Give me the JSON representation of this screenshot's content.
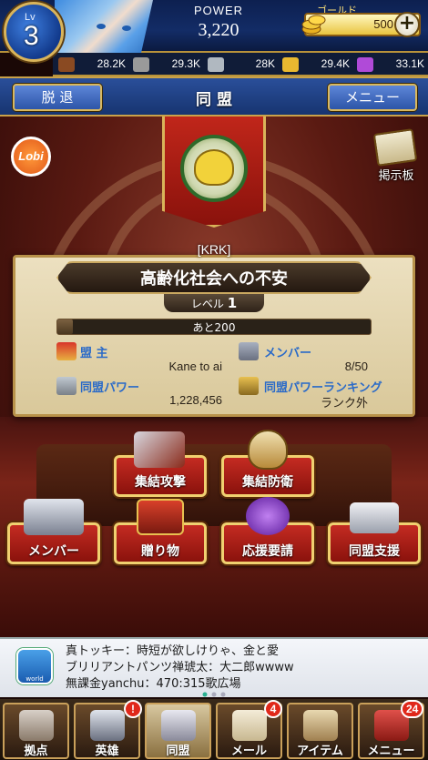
{
  "header": {
    "level_prefix": "Lv",
    "level": "3",
    "power_label": "POWER",
    "power_value": "3,220",
    "gold_label": "ゴールド",
    "gold_value": "500",
    "gold_add": "+"
  },
  "resources": [
    {
      "icon": "wood-log-icon",
      "value": "28.2K",
      "color": "#8a4a22"
    },
    {
      "icon": "stone-icon",
      "value": "29.3K",
      "color": "#9a9a9a"
    },
    {
      "icon": "iron-ingot-icon",
      "value": "28K",
      "color": "#b0b8c0"
    },
    {
      "icon": "gold-key-icon",
      "value": "29.4K",
      "color": "#e8b830"
    },
    {
      "icon": "crystal-icon",
      "value": "33.1K",
      "color": "#b04ad8"
    }
  ],
  "nav": {
    "leave_label": "脱 退",
    "title": "同 盟",
    "menu_label": "メニュー"
  },
  "side": {
    "lobi_label": "Lobi",
    "board_label": "掲示板"
  },
  "alliance": {
    "tag": "[KRK]",
    "name": "高齢化社会への不安",
    "level_label": "レベル",
    "level": "1",
    "xp_text": "あと200",
    "xp_progress": 0.05,
    "leader_label": "盟 主",
    "leader": "Kane to ai",
    "members_label": "メンバー",
    "members": "8/50",
    "power_label": "同盟パワー",
    "power": "1,228,456",
    "ranking_label": "同盟パワーランキング",
    "ranking": "ランク外"
  },
  "actions": {
    "rally_attack": "集結攻撃",
    "rally_defense": "集結防衛",
    "members": "メンバー",
    "gifts": "贈り物",
    "request_support": "応援要請",
    "alliance_support": "同盟支援"
  },
  "chat": {
    "world_label": "world",
    "lines": [
      "真トッキー：時短が欲しけりゃ、金と愛",
      "ブリリアントパンツ禅琥太：大二郎wwww",
      "無課金yanchu：470:315歌広場"
    ]
  },
  "bottom_nav": [
    {
      "label": "拠点",
      "icon": "castle-icon",
      "badge": ""
    },
    {
      "label": "英雄",
      "icon": "knight-helmet-icon",
      "badge": "!"
    },
    {
      "label": "同盟",
      "icon": "crossed-swords-icon",
      "badge": ""
    },
    {
      "label": "メール",
      "icon": "mail-envelope-icon",
      "badge": "4"
    },
    {
      "label": "アイテム",
      "icon": "item-bag-icon",
      "badge": ""
    },
    {
      "label": "メニュー",
      "icon": "menu-book-icon",
      "badge": "24"
    }
  ],
  "colors": {
    "accent_gold": "#d9b45a",
    "nav_blue": "#2a4f9a",
    "action_red": "#c42b22",
    "badge_red": "#e0281a"
  }
}
